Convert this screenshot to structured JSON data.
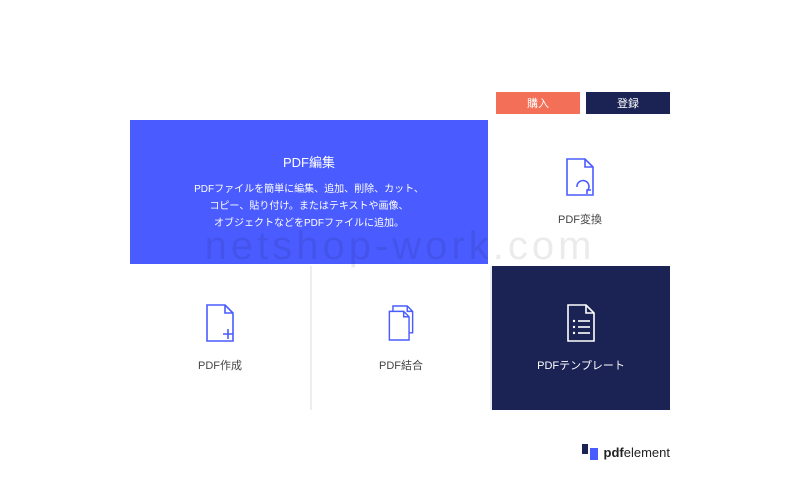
{
  "topbar": {
    "buy": "購入",
    "register": "登録"
  },
  "cards": {
    "edit": {
      "title": "PDF編集",
      "desc_l1": "PDFファイルを簡単に編集、追加、削除、カット、",
      "desc_l2": "コピー、貼り付け。またはテキストや画像、",
      "desc_l3": "オブジェクトなどをPDFファイルに追加。"
    },
    "convert": {
      "label": "PDF変換"
    },
    "create": {
      "label": "PDF作成"
    },
    "merge": {
      "label": "PDF結合"
    },
    "template": {
      "label": "PDFテンプレート"
    }
  },
  "brand": {
    "bold": "pdf",
    "rest": "element"
  },
  "watermark": "netshop-work.com",
  "colors": {
    "accent_blue": "#4a5cff",
    "accent_navy": "#1b2355",
    "accent_coral": "#f36f57"
  }
}
